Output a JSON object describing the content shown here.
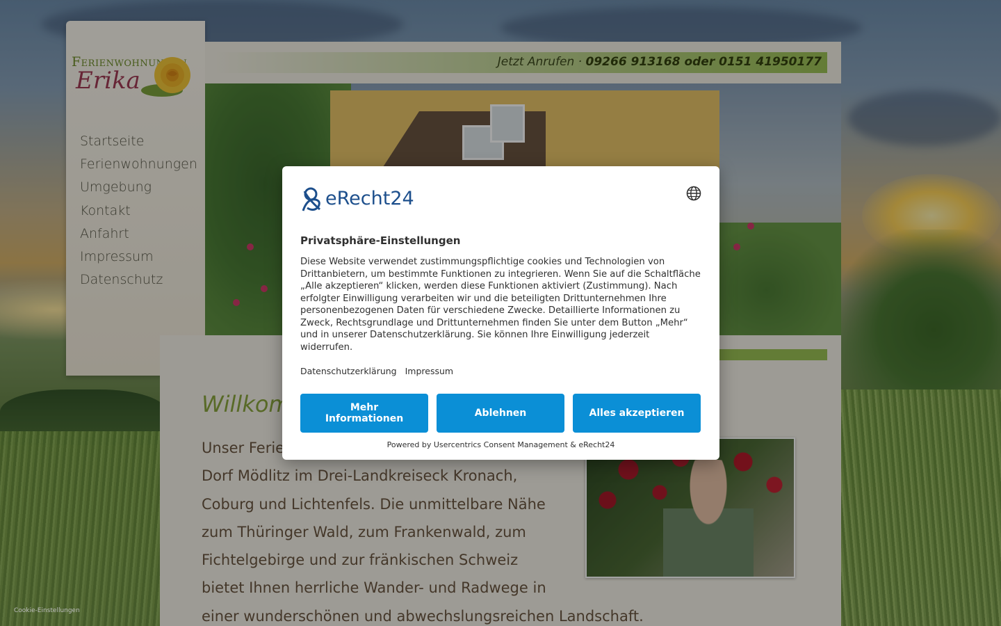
{
  "site": {
    "logo": {
      "line1": "Ferienwohnungen",
      "line2": "Erika"
    },
    "nav": [
      {
        "label": "Startseite"
      },
      {
        "label": "Ferienwohnungen"
      },
      {
        "label": "Umgebung"
      },
      {
        "label": "Kontakt"
      },
      {
        "label": "Anfahrt"
      },
      {
        "label": "Impressum"
      },
      {
        "label": "Datenschutz"
      }
    ],
    "phone": {
      "prefix": "Jetzt Anrufen · ",
      "numbers": "09266 913168 oder 0151 41950177"
    },
    "welcome": "Willkommen",
    "body_lines": [
      "Unser Ferie",
      "Dorf Mödlitz im Drei-Landkreiseck Kronach,",
      "Coburg und Lichtenfels. Die unmittelbare Nähe",
      "zum Thüringer Wald, zum Frankenwald, zum",
      "Fichtelgebirge und zur fränkischen Schweiz",
      "bietet Ihnen herrliche Wander- und Radwege in",
      "einer wunderschönen und abwechslungsreichen Landschaft."
    ],
    "cookie_link": "Cookie-Einstellungen"
  },
  "consent": {
    "brand": "eRecht24",
    "title": "Privatsphäre-Einstellungen",
    "text": "Diese Website verwendet zustimmungspflichtige cookies und Technologien von Drittanbietern, um bestimmte Funktionen zu integrieren. Wenn Sie auf die Schaltfläche „Alle akzeptieren“ klicken, werden diese Funktionen aktiviert (Zustimmung). Nach erfolgter Einwilligung verarbeiten wir und die beteiligten Drittunternehmen Ihre personenbezogenen Daten für verschiedene Zwecke. Detaillierte Informationen zu Zweck, Rechtsgrundlage und Drittunternehmen finden Sie unter dem Button „Mehr“ und in unserer Datenschutzerklärung. Sie können Ihre Einwilligung jederzeit widerrufen.",
    "links": {
      "privacy": "Datenschutzerklärung",
      "imprint": "Impressum"
    },
    "buttons": {
      "more": "Mehr Informationen",
      "deny": "Ablehnen",
      "accept": "Alles akzeptieren"
    },
    "powered_by": "Powered by Usercentrics Consent Management & eRecht24",
    "accent_color": "#0b8fd6"
  }
}
